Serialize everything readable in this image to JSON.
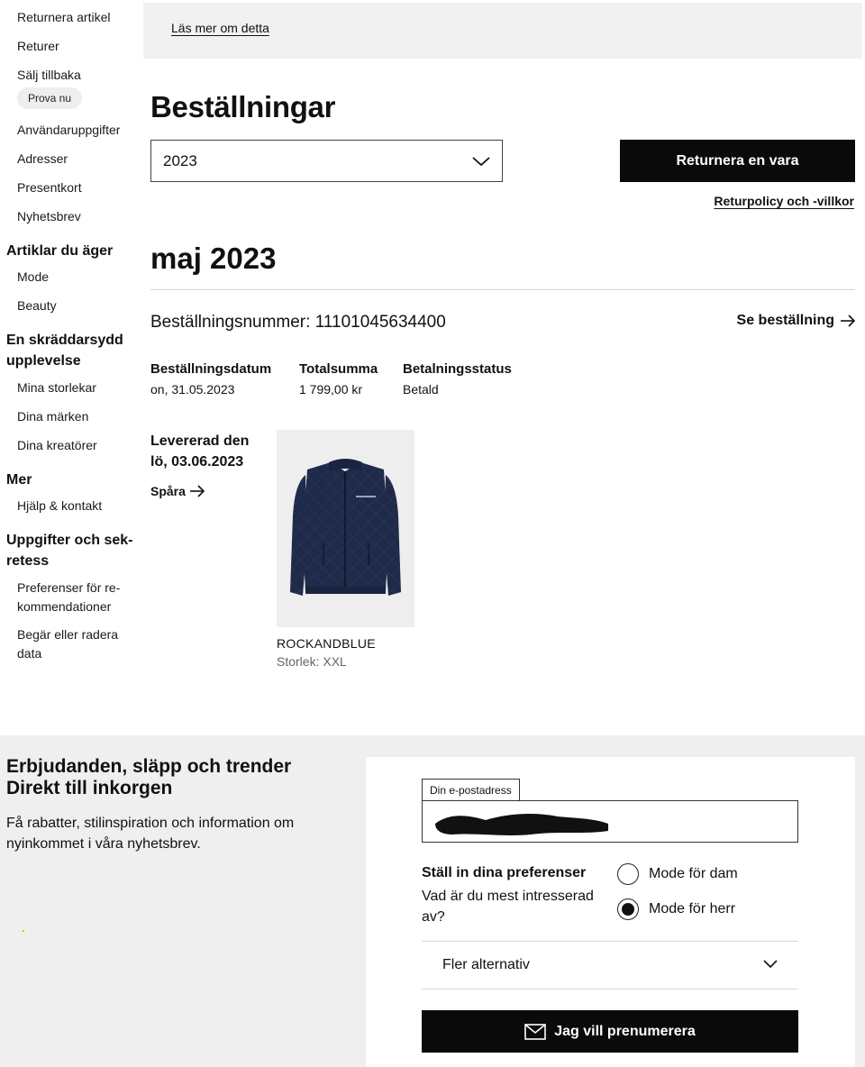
{
  "sidebar": {
    "links_top": [
      {
        "label": "Returnera artikel"
      },
      {
        "label": "Returer"
      },
      {
        "label": "Sälj tillbaka"
      }
    ],
    "try_now": "Prova nu",
    "links_account": [
      {
        "label": "Användaruppgifter"
      },
      {
        "label": "Adresser"
      },
      {
        "label": "Presentkort"
      },
      {
        "label": "Nyhetsbrev"
      }
    ],
    "section_owned": {
      "heading": "Artiklar du äger",
      "items": [
        {
          "label": "Mode"
        },
        {
          "label": "Beauty"
        }
      ]
    },
    "section_tailored": {
      "heading": "En skräddarsydd upplevelse",
      "items": [
        {
          "label": "Mina storlekar"
        },
        {
          "label": "Dina märken"
        },
        {
          "label": "Dina kreatörer"
        }
      ]
    },
    "section_more": {
      "heading": "Mer",
      "items": [
        {
          "label": "Hjälp & kontakt"
        }
      ]
    },
    "section_privacy": {
      "heading": "Uppgifter och sek-retess",
      "items": [
        {
          "label": "Preferenser för re-kommendationer"
        },
        {
          "label": "Begär eller radera data"
        }
      ]
    }
  },
  "banner": {
    "link": "Läs mer om detta"
  },
  "orders": {
    "title": "Beställningar",
    "year_select": {
      "value": "2023"
    },
    "return_button": "Returnera en vara",
    "policy_link": "Returpolicy och -villkor",
    "month": "maj 2023",
    "order": {
      "number_text": "Beställningsnummer: 11101045634400",
      "see_order": "Se beställning",
      "date_label": "Beställningsdatum",
      "date_value": "on, 31.05.2023",
      "total_label": "Totalsumma",
      "total_value": "1 799,00 kr",
      "status_label": "Betalningsstatus",
      "status_value": "Betald",
      "delivered": "Levererad den lö, 03.06.2023",
      "track": "Spåra",
      "product": {
        "brand": "ROCKANDBLUE",
        "size": "Storlek: XXL"
      }
    }
  },
  "newsletter": {
    "title": "Erbjudanden, släpp och trender Direkt till inkorgen",
    "description": "Få rabatter, stilinspiration och information om nyinkommet i våra nyhetsbrev.",
    "email_label": "Din e-postadress",
    "pref_title": "Ställ in dina preferenser",
    "pref_question": "Vad är du mest intresserad av?",
    "options": [
      {
        "label": "Mode för dam",
        "selected": false
      },
      {
        "label": "Mode för herr",
        "selected": true
      }
    ],
    "more_options": "Fler alternativ",
    "subscribe": "Jag vill prenumerera"
  },
  "icons": [
    "chevron-down-icon",
    "arrow-right-icon",
    "mail-icon"
  ],
  "colors": {
    "primary_button": "#0a0a0a",
    "banner_bg": "#f1f1f1",
    "newsletter_bg": "#efefef"
  }
}
